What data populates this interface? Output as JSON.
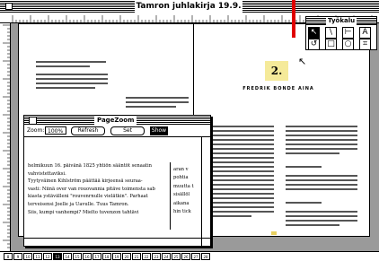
{
  "window": {
    "title": "Tamron juhlakirja 19.9."
  },
  "toolbox": {
    "title": "Työkalu",
    "tools": [
      {
        "name": "arrow-tool",
        "glyph": "↖"
      },
      {
        "name": "line-tool",
        "glyph": "\\"
      },
      {
        "name": "orthogonal-line-tool",
        "glyph": "⊢"
      },
      {
        "name": "text-tool",
        "glyph": "A"
      },
      {
        "name": "rotate-tool",
        "glyph": "↺"
      },
      {
        "name": "rectangle-tool",
        "glyph": "□"
      },
      {
        "name": "ellipse-tool",
        "glyph": "○"
      },
      {
        "name": "crop-tool",
        "glyph": "⌗"
      }
    ]
  },
  "spread": {
    "page_number": "2.",
    "heading": "FREDRIK BONDE AINA"
  },
  "pagezoom": {
    "title": "PageZoom",
    "zoom_label": "Zoom:",
    "zoom_value": "100%",
    "buttons": {
      "refresh": "Refresh",
      "set": "Set",
      "show": "Show"
    },
    "text_lines": [
      "helmikuun 16. päivänä 1825 yhtiön sääntöt senaatin",
      "vahvistettaviksi.",
      "    Tyytyväinen Kihlström päättää kirjeensä seuraa-",
      "vasti: Niinä over van rouovannia pitäve toimensta sab",
      "kiasta ystävälleni \"rouvenrnulle vielätkin\". Parhaat",
      "terveisensi Joelle ja Uavulle. Tuus Tamron.",
      "    Siis, kumpi vanhempi? Mielto tuvenzon tahtävi"
    ],
    "right_col": [
      "aran v",
      "pohtia",
      "muutta t",
      "sisällöl",
      "aikana",
      "hin tick"
    ]
  },
  "pagebar": {
    "pages": [
      "8",
      "9",
      "10",
      "11",
      "12",
      "13",
      "14",
      "15",
      "16",
      "17",
      "18",
      "19",
      "20",
      "21",
      "22",
      "23",
      "24",
      "25",
      "26",
      "27",
      "28"
    ],
    "active_index": 5
  }
}
